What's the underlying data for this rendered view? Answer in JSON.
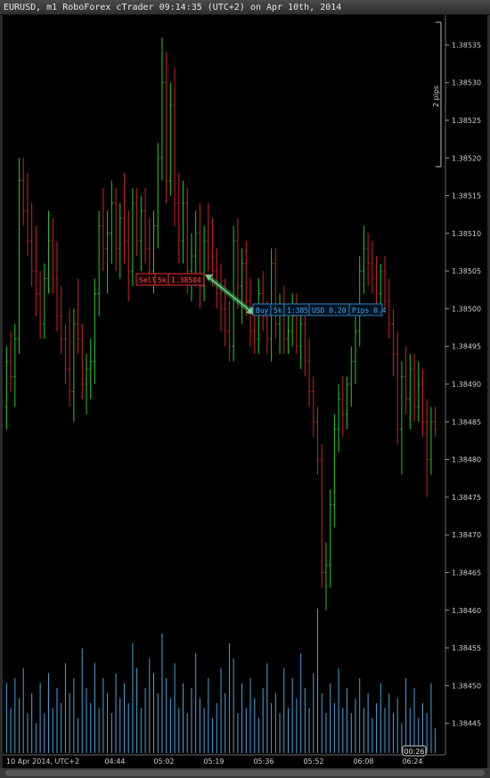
{
  "window": {
    "title": "EURUSD, m1 RoboForex cTrader 09:14:35 (UTC+2) on Apr 10th, 2014"
  },
  "overlay": {
    "pip_ruler_label": "2 pips",
    "current_time_marker": "00:26"
  },
  "trades": {
    "sell": {
      "side": "Sell",
      "volume": "5k",
      "price": "1.38504"
    },
    "buy": {
      "side": "Buy",
      "volume": "5k",
      "price": "1:385",
      "usd": "USD 0.20",
      "pips": "Pips 0.4"
    }
  },
  "colors": {
    "up": "#22cc22",
    "down": "#d42020",
    "volume": "#4aa3d8",
    "axis_text": "#cfcfcf",
    "sell_box": "#e03030",
    "buy_box": "#2f7fbf",
    "connector": "#2aa04a"
  },
  "chart_data": {
    "type": "bar",
    "symbol": "EURUSD",
    "timeframe": "m1",
    "ylim": [
      1.38442,
      1.38538
    ],
    "y_ticks": [
      "1.38535",
      "1.38530",
      "1.38525",
      "1.38520",
      "1.38515",
      "1.38510",
      "1.38505",
      "1.38500",
      "1.38495",
      "1.38490",
      "1.38485",
      "1.38480",
      "1.38475",
      "1.38470",
      "1.38465",
      "1.38460",
      "1.38455",
      "1.38450",
      "1.38445"
    ],
    "x_ticks": [
      "10 Apr 2014, UTC+2",
      "04:44",
      "05:02",
      "05:19",
      "05:36",
      "05:52",
      "06:08",
      "06:24"
    ],
    "ohlc": [
      [
        1.38487,
        1.38495,
        1.38484,
        1.38493
      ],
      [
        1.38493,
        1.38497,
        1.38489,
        1.38491
      ],
      [
        1.38491,
        1.38498,
        1.38487,
        1.38496
      ],
      [
        1.38496,
        1.3852,
        1.38494,
        1.38517
      ],
      [
        1.38517,
        1.3852,
        1.38511,
        1.38513
      ],
      [
        1.38513,
        1.38518,
        1.38507,
        1.38509
      ],
      [
        1.38509,
        1.38514,
        1.38503,
        1.38505
      ],
      [
        1.38505,
        1.38511,
        1.38499,
        1.38502
      ],
      [
        1.38502,
        1.38505,
        1.38496,
        1.38498
      ],
      [
        1.38498,
        1.38506,
        1.38496,
        1.38504
      ],
      [
        1.38504,
        1.38513,
        1.38502,
        1.38509
      ],
      [
        1.38509,
        1.38512,
        1.38502,
        1.38504
      ],
      [
        1.38504,
        1.38509,
        1.38497,
        1.38499
      ],
      [
        1.38499,
        1.38503,
        1.38494,
        1.38496
      ],
      [
        1.38496,
        1.38498,
        1.3849,
        1.38492
      ],
      [
        1.38492,
        1.385,
        1.38487,
        1.38489
      ],
      [
        1.38489,
        1.385,
        1.38485,
        1.38498
      ],
      [
        1.38498,
        1.38504,
        1.38494,
        1.38496
      ],
      [
        1.38496,
        1.38498,
        1.38488,
        1.3849
      ],
      [
        1.3849,
        1.38494,
        1.38486,
        1.38492
      ],
      [
        1.38492,
        1.38496,
        1.38488,
        1.38493
      ],
      [
        1.38493,
        1.38504,
        1.3849,
        1.38502
      ],
      [
        1.38502,
        1.38513,
        1.38499,
        1.38511
      ],
      [
        1.38511,
        1.38516,
        1.38505,
        1.38508
      ],
      [
        1.38508,
        1.38513,
        1.38502,
        1.3851
      ],
      [
        1.3851,
        1.38517,
        1.38506,
        1.38514
      ],
      [
        1.38514,
        1.38516,
        1.38505,
        1.38508
      ],
      [
        1.38508,
        1.38514,
        1.38504,
        1.38512
      ],
      [
        1.38512,
        1.38518,
        1.38506,
        1.38509
      ],
      [
        1.38509,
        1.38513,
        1.38501,
        1.38505
      ],
      [
        1.38505,
        1.38516,
        1.38503,
        1.38514
      ],
      [
        1.38514,
        1.38516,
        1.38507,
        1.38509
      ],
      [
        1.38509,
        1.38515,
        1.38505,
        1.38513
      ],
      [
        1.38513,
        1.38516,
        1.38506,
        1.38508
      ],
      [
        1.38508,
        1.38512,
        1.38503,
        1.38505
      ],
      [
        1.38505,
        1.38513,
        1.38502,
        1.38511
      ],
      [
        1.38511,
        1.38522,
        1.38508,
        1.3852
      ],
      [
        1.3852,
        1.38536,
        1.38517,
        1.3853
      ],
      [
        1.3853,
        1.38534,
        1.38514,
        1.38517
      ],
      [
        1.38517,
        1.3853,
        1.38515,
        1.38527
      ],
      [
        1.38527,
        1.38532,
        1.38511,
        1.38514
      ],
      [
        1.38514,
        1.38518,
        1.38506,
        1.38509
      ],
      [
        1.38509,
        1.38517,
        1.38506,
        1.38514
      ],
      [
        1.38514,
        1.38516,
        1.38502,
        1.38505
      ],
      [
        1.38505,
        1.3851,
        1.38501,
        1.38507
      ],
      [
        1.38507,
        1.38513,
        1.38503,
        1.3851
      ],
      [
        1.3851,
        1.38514,
        1.385,
        1.38503
      ],
      [
        1.38503,
        1.38511,
        1.38501,
        1.38509
      ],
      [
        1.38509,
        1.38514,
        1.38505,
        1.38507
      ],
      [
        1.38507,
        1.38512,
        1.38503,
        1.38505
      ],
      [
        1.38505,
        1.38508,
        1.385,
        1.38502
      ],
      [
        1.38502,
        1.38506,
        1.38497,
        1.385
      ],
      [
        1.385,
        1.38504,
        1.38495,
        1.38497
      ],
      [
        1.38497,
        1.38501,
        1.38493,
        1.38495
      ],
      [
        1.38495,
        1.38511,
        1.38493,
        1.38509
      ],
      [
        1.38509,
        1.38512,
        1.385,
        1.38503
      ],
      [
        1.38503,
        1.38508,
        1.38498,
        1.38506
      ],
      [
        1.38506,
        1.38509,
        1.38499,
        1.38501
      ],
      [
        1.38501,
        1.38504,
        1.38495,
        1.38497
      ],
      [
        1.38497,
        1.385,
        1.38494,
        1.38496
      ],
      [
        1.38496,
        1.38504,
        1.38494,
        1.38502
      ],
      [
        1.38502,
        1.38505,
        1.38497,
        1.38499
      ],
      [
        1.38499,
        1.38501,
        1.38494,
        1.38496
      ],
      [
        1.38496,
        1.38508,
        1.38493,
        1.38506
      ],
      [
        1.38506,
        1.38508,
        1.38496,
        1.38498
      ],
      [
        1.38498,
        1.38502,
        1.38494,
        1.385
      ],
      [
        1.385,
        1.38503,
        1.38494,
        1.38496
      ],
      [
        1.38496,
        1.38499,
        1.38494,
        1.38497
      ],
      [
        1.38497,
        1.38502,
        1.38495,
        1.38499
      ],
      [
        1.38499,
        1.38502,
        1.38494,
        1.38495
      ],
      [
        1.38495,
        1.385,
        1.38492,
        1.38498
      ],
      [
        1.38498,
        1.385,
        1.38491,
        1.38493
      ],
      [
        1.38493,
        1.38496,
        1.38487,
        1.38489
      ],
      [
        1.38489,
        1.38491,
        1.38483,
        1.38485
      ],
      [
        1.38485,
        1.38487,
        1.38478,
        1.3848
      ],
      [
        1.3848,
        1.38482,
        1.38463,
        1.38465
      ],
      [
        1.38465,
        1.38469,
        1.3846,
        1.38466
      ],
      [
        1.38466,
        1.38476,
        1.38463,
        1.38474
      ],
      [
        1.38474,
        1.38486,
        1.38471,
        1.38484
      ],
      [
        1.38484,
        1.3849,
        1.38481,
        1.38488
      ],
      [
        1.38488,
        1.38491,
        1.38483,
        1.38486
      ],
      [
        1.38486,
        1.38491,
        1.38484,
        1.3849
      ],
      [
        1.3849,
        1.38495,
        1.38487,
        1.38493
      ],
      [
        1.38493,
        1.38499,
        1.3849,
        1.38497
      ],
      [
        1.38497,
        1.38507,
        1.38495,
        1.38505
      ],
      [
        1.38505,
        1.38511,
        1.38502,
        1.38508
      ],
      [
        1.38508,
        1.3851,
        1.38503,
        1.38506
      ],
      [
        1.38506,
        1.38509,
        1.38502,
        1.38504
      ],
      [
        1.38504,
        1.38507,
        1.385,
        1.38502
      ],
      [
        1.38502,
        1.38506,
        1.38499,
        1.38505
      ],
      [
        1.38505,
        1.38507,
        1.385,
        1.38501
      ],
      [
        1.38501,
        1.38504,
        1.38496,
        1.38498
      ],
      [
        1.38498,
        1.385,
        1.38491,
        1.38494
      ],
      [
        1.38494,
        1.38497,
        1.38482,
        1.38484
      ],
      [
        1.38484,
        1.38493,
        1.38478,
        1.38491
      ],
      [
        1.38491,
        1.38495,
        1.38486,
        1.38488
      ],
      [
        1.38488,
        1.38494,
        1.38484,
        1.38492
      ],
      [
        1.38492,
        1.38494,
        1.38485,
        1.38487
      ],
      [
        1.38487,
        1.38493,
        1.38485,
        1.3849
      ],
      [
        1.3849,
        1.38492,
        1.38483,
        1.38485
      ],
      [
        1.38485,
        1.38488,
        1.38475,
        1.3848
      ],
      [
        1.3848,
        1.38487,
        1.38478,
        1.38485
      ],
      [
        1.38485,
        1.38487,
        1.38483,
        1.38484
      ]
    ],
    "volume": [
      14,
      9,
      15,
      11,
      17,
      8,
      12,
      6,
      14,
      8,
      16,
      9,
      13,
      10,
      18,
      12,
      15,
      7,
      21,
      13,
      10,
      18,
      9,
      15,
      12,
      8,
      16,
      11,
      14,
      10,
      22,
      17,
      9,
      13,
      19,
      16,
      12,
      24,
      15,
      11,
      18,
      9,
      14,
      8,
      13,
      20,
      11,
      9,
      15,
      7,
      10,
      17,
      12,
      22,
      19,
      8,
      14,
      9,
      15,
      11,
      7,
      13,
      18,
      10,
      12,
      8,
      17,
      9,
      15,
      11,
      20,
      13,
      9,
      16,
      29,
      12,
      8,
      14,
      10,
      17,
      9,
      13,
      8,
      11,
      15,
      9,
      12,
      7,
      10,
      14,
      9,
      12,
      8,
      11,
      6,
      15,
      9,
      13,
      7,
      10,
      8,
      14,
      5
    ],
    "volume_max": 30
  }
}
